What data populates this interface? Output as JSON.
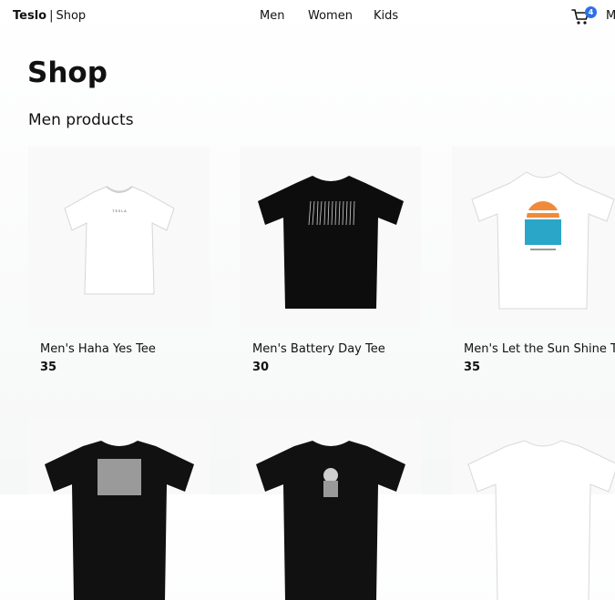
{
  "header": {
    "brand_name": "Teslo",
    "brand_separator": "|",
    "brand_section": "Shop",
    "nav": [
      "Men",
      "Women",
      "Kids"
    ],
    "cart_icon": "shopping-cart-icon",
    "cart_count": "4",
    "menu_label": "M"
  },
  "page": {
    "title": "Shop",
    "subtitle": "Men products"
  },
  "products": [
    {
      "title": "Men's Haha Yes Tee",
      "price": "35",
      "shirt_color": "#ffffff"
    },
    {
      "title": "Men's Battery Day Tee",
      "price": "30",
      "shirt_color": "#0d0d0d"
    },
    {
      "title": "Men's Let the Sun Shine Tee",
      "price": "35",
      "shirt_color": "#ffffff"
    },
    {
      "title": "",
      "price": "",
      "shirt_color": "#111111"
    },
    {
      "title": "",
      "price": "",
      "shirt_color": "#111111"
    },
    {
      "title": "",
      "price": "",
      "shirt_color": "#ffffff"
    }
  ],
  "colors": {
    "accent": "#2f6fe4",
    "badge_text": "#ffffff"
  }
}
